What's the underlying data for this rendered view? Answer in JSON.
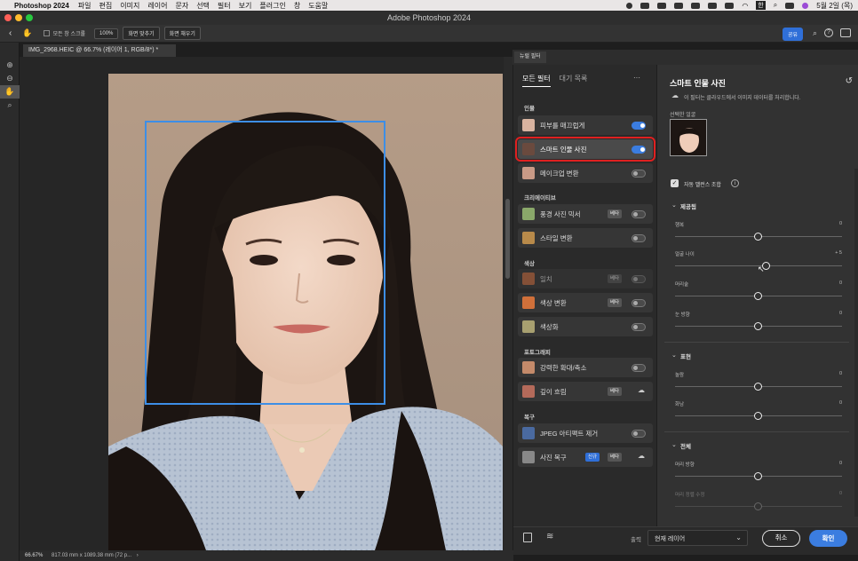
{
  "menubar": {
    "app_name": "Photoshop 2024",
    "items": [
      "파일",
      "편집",
      "이미지",
      "레이어",
      "문자",
      "선택",
      "필터",
      "보기",
      "플러그인",
      "창",
      "도움말"
    ],
    "date": "5월 2일 (목)",
    "input_lang": "한"
  },
  "window": {
    "title": "Adobe Photoshop 2024"
  },
  "options_bar": {
    "scroll_all_label": "모든 창 스크롤",
    "zoom_label": "100%",
    "fit_screen_label": "화면 맞추기",
    "fill_screen_label": "화면 채우기",
    "share_label": "공유"
  },
  "document": {
    "tab_title": "IMG_2968.HEIC @ 66.7% (레이어 1, RGB/8*) *",
    "zoom_status": "66.67%",
    "size_status": "817.03 mm x 1089.38 mm (72 p..."
  },
  "neural": {
    "panel_tab": "뉴럴 필터",
    "tabs": {
      "all": "모든 필터",
      "waitlist": "대기 목록"
    },
    "more_label": "···",
    "sections": {
      "portraits": "인물",
      "creative": "크리에이티브",
      "color": "색상",
      "photography": "포토그래피",
      "restoration": "복구"
    },
    "filters": {
      "skin": {
        "label": "피부를 매끄럽게",
        "on": true
      },
      "portrait": {
        "label": "스마트 인물 사진",
        "on": true
      },
      "makeup": {
        "label": "메이크업 변환",
        "on": false
      },
      "landscape": {
        "label": "풍경 사진 믹서",
        "badge": "베타"
      },
      "style": {
        "label": "스타일 변환"
      },
      "harmonize": {
        "label": "일치",
        "badge": "베타"
      },
      "colortransfer": {
        "label": "색상 변환",
        "badge": "베타"
      },
      "colorize": {
        "label": "색상화"
      },
      "superzoom": {
        "label": "강력한 확대/축소"
      },
      "depthblur": {
        "label": "깊이 흐림",
        "badge": "베타"
      },
      "jpeg": {
        "label": "JPEG 아티팩트 제거"
      },
      "restore": {
        "label": "사진 복구",
        "badge_new": "신규",
        "badge": "베타"
      }
    }
  },
  "settings": {
    "title": "스마트 인물 사진",
    "cloud_note": "이 필터는 클라우드에서 이미지 데이터를 처리합니다.",
    "selected_face_label": "선택한 얼굴",
    "auto_balance_label": "자동 밸런스 조합",
    "featured_section": "제공됨",
    "expression_section": "표현",
    "global_section": "전체",
    "sliders": {
      "happiness": {
        "label": "행복",
        "value": "0",
        "level": 0.5
      },
      "facial_age": {
        "label": "얼굴 나이",
        "value": "+ 5",
        "level": 0.55
      },
      "hair": {
        "label": "머리숱",
        "value": "0",
        "level": 0.5
      },
      "eye_direction": {
        "label": "눈 방향",
        "value": "0",
        "level": 0.5
      },
      "surprise": {
        "label": "놀람",
        "value": "0",
        "level": 0.5
      },
      "anger": {
        "label": "화남",
        "value": "0",
        "level": 0.5
      },
      "head_direction": {
        "label": "머리 방향",
        "value": "0",
        "level": 0.5
      },
      "head_align": {
        "label": "머리 정렬 수정",
        "value": "0",
        "level": 0.5
      }
    },
    "output_label": "출력",
    "output_value": "현재 레이어",
    "cancel_label": "취소",
    "ok_label": "확인"
  },
  "colors": {
    "accent": "#3b7de0",
    "selection": "#e02020",
    "face_box": "#3d8ee6"
  }
}
